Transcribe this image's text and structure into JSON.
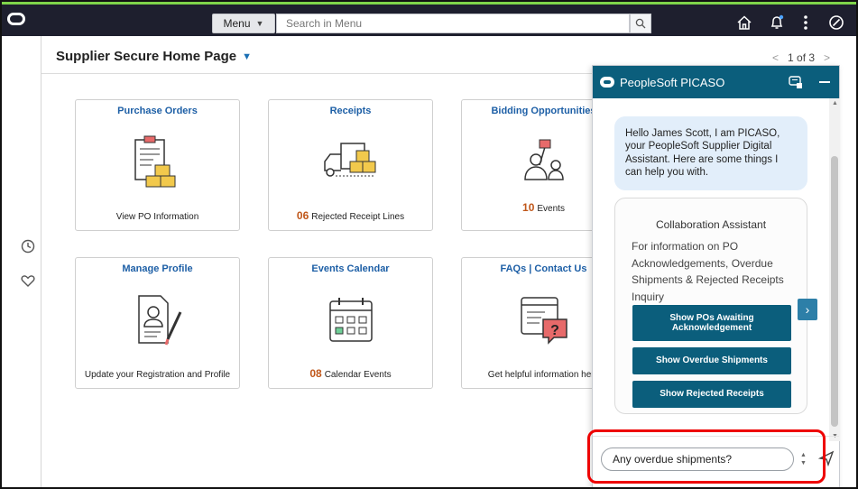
{
  "topbar": {
    "menu_label": "Menu",
    "search_placeholder": "Search in Menu"
  },
  "page": {
    "title": "Supplier Secure Home Page",
    "pager": "1 of 3"
  },
  "tiles": [
    {
      "title": "Purchase Orders",
      "count": "",
      "footer": "View PO Information",
      "icon": "purchase-orders-icon"
    },
    {
      "title": "Receipts",
      "count": "06",
      "footer": "Rejected Receipt Lines",
      "icon": "delivery-truck-icon"
    },
    {
      "title": "Bidding Opportunities",
      "count": "10",
      "footer": "Events",
      "icon": "bidding-icon"
    },
    {
      "title": "Manage Profile",
      "count": "",
      "footer": "Update your Registration and Profile",
      "icon": "profile-document-icon"
    },
    {
      "title": "Events Calendar",
      "count": "08",
      "footer": "Calendar Events",
      "icon": "calendar-icon"
    },
    {
      "title": "FAQs | Contact Us",
      "count": "",
      "footer": "Get helpful information here",
      "icon": "faq-help-icon"
    }
  ],
  "chat": {
    "title": "PeopleSoft PICASO",
    "greeting": "Hello James Scott, I am PICASO, your PeopleSoft Supplier Digital Assistant. Here are some things I can help you with.",
    "card_title": "Collaboration Assistant",
    "card_text": "For information on PO Acknowledgements, Overdue Shipments & Rejected Receipts Inquiry",
    "actions": [
      "Show POs Awaiting Acknowledgement",
      "Show Overdue Shipments",
      "Show Rejected Receipts"
    ],
    "input_value": "Any overdue shipments?"
  },
  "colors": {
    "topbar_bg": "#1e1f2e",
    "chat_accent": "#0b5e7c",
    "tile_title": "#1d5fa6",
    "count": "#c0571a",
    "highlight": "#e00000"
  }
}
